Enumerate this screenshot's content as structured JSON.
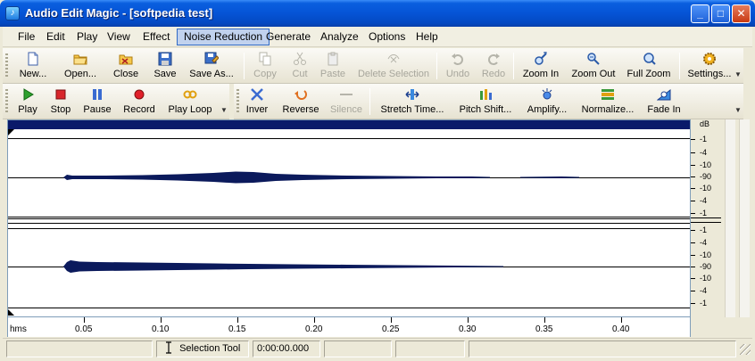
{
  "window": {
    "title": "Audio Edit Magic - [softpedia test]",
    "minimize": "_",
    "maximize": "□",
    "close": "✕"
  },
  "menu": [
    {
      "label": "File"
    },
    {
      "label": "Edit"
    },
    {
      "label": "Play"
    },
    {
      "label": "View"
    },
    {
      "label": "Effect"
    },
    {
      "label": "Noise Reduction"
    },
    {
      "label": "Generate"
    },
    {
      "label": "Analyze"
    },
    {
      "label": "Options"
    },
    {
      "label": "Help"
    }
  ],
  "toolbar1": {
    "new": "New...",
    "open": "Open...",
    "close": "Close",
    "save": "Save",
    "save_as": "Save As...",
    "copy": "Copy",
    "cut": "Cut",
    "paste": "Paste",
    "delete_selection": "Delete Selection",
    "undo": "Undo",
    "redo": "Redo",
    "zoom_in": "Zoom In",
    "zoom_out": "Zoom Out",
    "full_zoom": "Full Zoom",
    "settings": "Settings..."
  },
  "toolbar2": {
    "play": "Play",
    "stop": "Stop",
    "pause": "Pause",
    "record": "Record",
    "play_loop": "Play Loop",
    "inver": "Inver",
    "reverse": "Reverse",
    "silence": "Silence",
    "stretch_time": "Stretch Time...",
    "pitch_shift": "Pitch Shift...",
    "amplify": "Amplify...",
    "normalize": "Normalize...",
    "fade_in": "Fade In"
  },
  "db_scale": {
    "unit": "dB",
    "labels_top": [
      "-1",
      "-4",
      "-10",
      "-90",
      "-10",
      "-4",
      "-1"
    ],
    "labels_bottom": [
      "-1",
      "-4",
      "-10",
      "-90",
      "-10",
      "-4",
      "-1"
    ]
  },
  "ruler": {
    "unit": "hms",
    "labels": [
      "0.05",
      "0.10",
      "0.15",
      "0.20",
      "0.25",
      "0.30",
      "0.35",
      "0.40"
    ]
  },
  "status": {
    "tool": "Selection Tool",
    "time": "0:00:00.000"
  },
  "colors": {
    "waveform": "#0b1a5c",
    "titlebar": "#0554d6",
    "menu_highlight": "#c1d2ee"
  }
}
